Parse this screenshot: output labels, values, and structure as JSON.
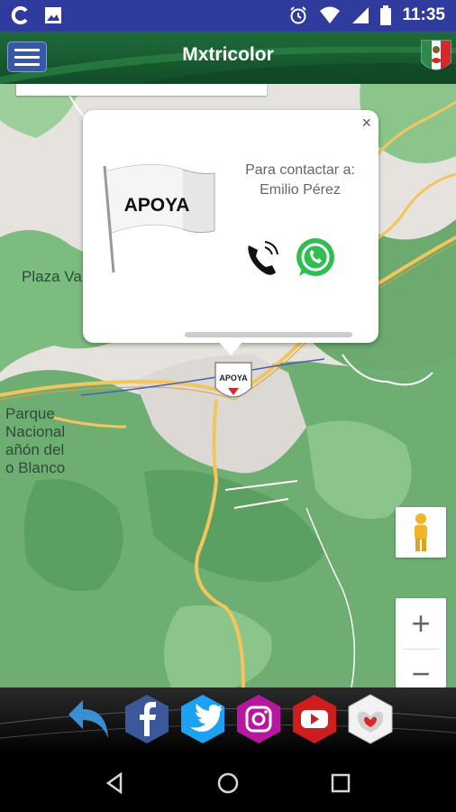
{
  "status_bar": {
    "time": "11:35",
    "left_icons": [
      "c-app-icon",
      "image-icon"
    ],
    "right_icons": [
      "alarm-icon",
      "wifi-icon",
      "signal-icon",
      "battery-icon"
    ],
    "background": "#2f3c9e"
  },
  "app_bar": {
    "title": "Mxtricolor",
    "menu_icon": "hamburger-menu-icon",
    "logo_icon": "mxtricolor-logo-icon"
  },
  "map": {
    "labels": {
      "plaza": "Plaza Va",
      "park_line1": "Parque",
      "park_line2": "Nacional",
      "park_line3": "añón del",
      "park_line4": "o Blanco"
    },
    "colors": {
      "green": "#5c9f62",
      "light_green": "#9ccf9b",
      "road": "#f3c55c",
      "background": "#e6e3df"
    }
  },
  "info_window": {
    "flag_text": "APOYA",
    "contact_line1": "Para contactar a:",
    "contact_line2": "Emilio Pérez",
    "close_label": "×",
    "call_icon": "phone-call-icon",
    "whatsapp_icon": "whatsapp-icon"
  },
  "marker": {
    "text": "APOYA"
  },
  "map_controls": {
    "zoom_in": "+",
    "zoom_out": "−",
    "street_view_icon": "pegman-icon"
  },
  "social_bar": {
    "items": [
      "back-arrow-icon",
      "facebook-icon",
      "twitter-icon",
      "instagram-icon",
      "youtube-icon",
      "tricolor-heart-icon"
    ],
    "colors": {
      "facebook": "#3b5998",
      "twitter": "#1da1f2",
      "instagram": "#b5179e",
      "youtube": "#cc1e1e",
      "back": "#3a8fd4"
    }
  },
  "nav_bar": {
    "items": [
      "back-nav-icon",
      "home-nav-icon",
      "recents-nav-icon"
    ]
  }
}
